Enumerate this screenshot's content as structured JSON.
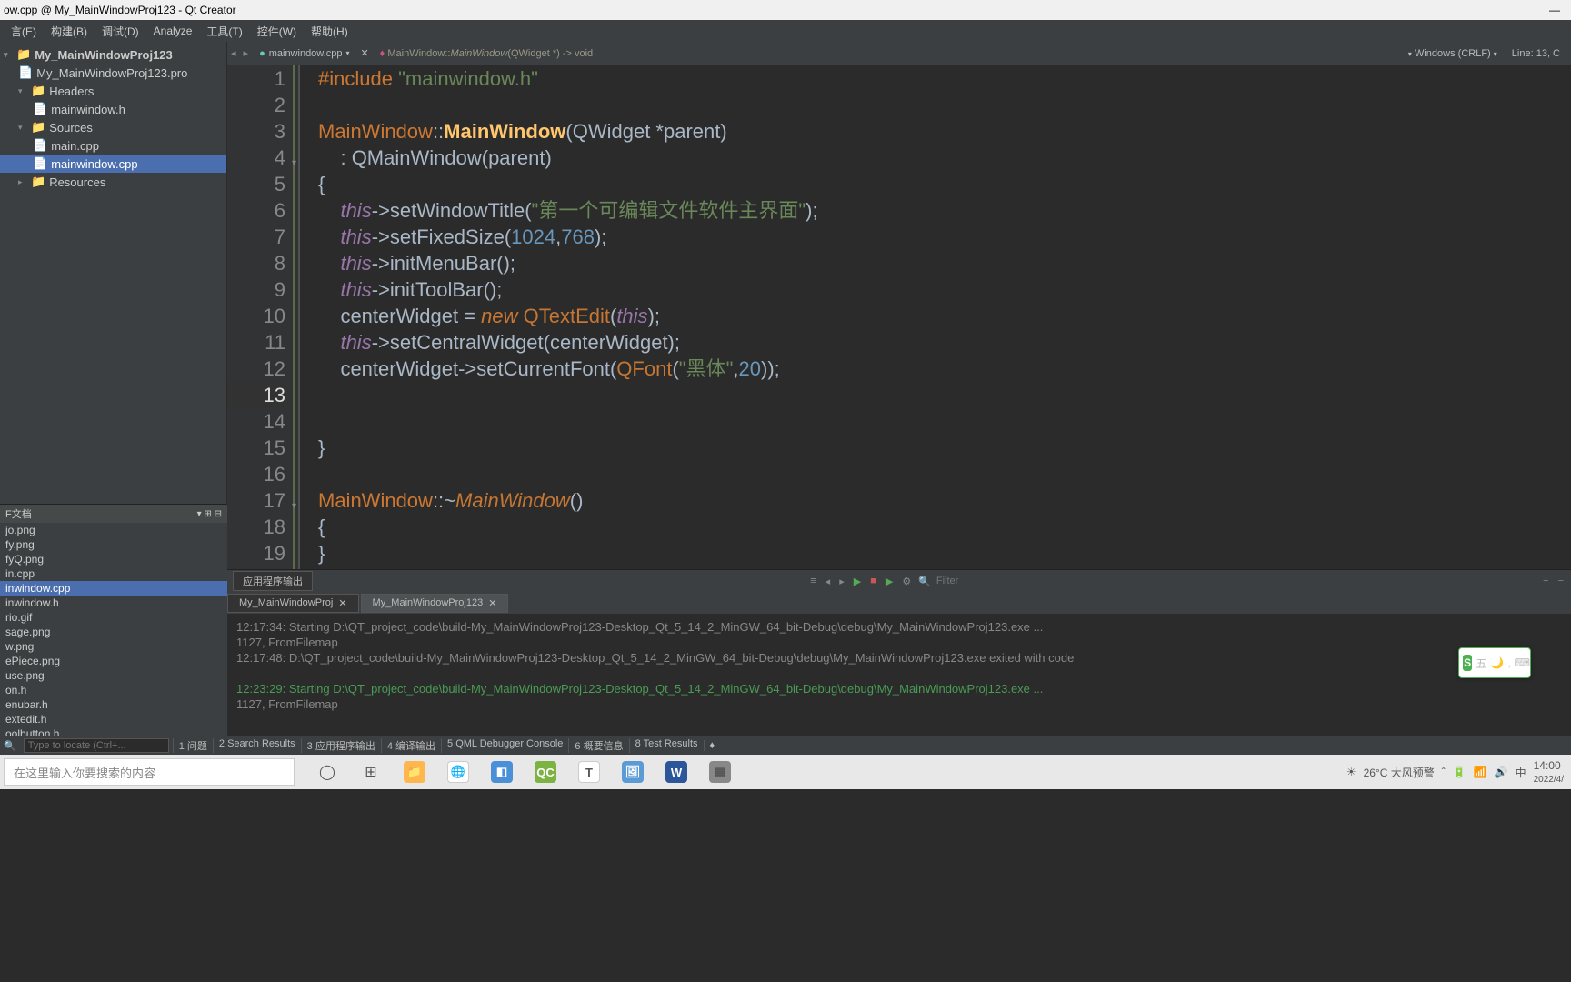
{
  "window": {
    "title": "ow.cpp @ My_MainWindowProj123 - Qt Creator",
    "minimize": "—"
  },
  "menubar": {
    "items": [
      {
        "label": "言(E)",
        "key": "E"
      },
      {
        "label": "构建(B)",
        "key": "B"
      },
      {
        "label": "调试(D)",
        "key": "D"
      },
      {
        "label": "Analyze",
        "key": ""
      },
      {
        "label": "工具(T)",
        "key": "T"
      },
      {
        "label": "控件(W)",
        "key": "W"
      },
      {
        "label": "帮助(H)",
        "key": "H"
      }
    ]
  },
  "project_tree": {
    "root": "My_MainWindowProj123",
    "pro_file": "My_MainWindowProj123.pro",
    "headers_folder": "Headers",
    "header_file": "mainwindow.h",
    "sources_folder": "Sources",
    "main_cpp": "main.cpp",
    "mainwindow_cpp": "mainwindow.cpp",
    "resources_folder": "Resources"
  },
  "editor": {
    "filename": "mainwindow.cpp",
    "breadcrumb_class": "MainWindow::",
    "breadcrumb_func": "MainWindow",
    "breadcrumb_sig": "(QWidget *) -> void",
    "encoding": "Windows (CRLF)",
    "cursor_pos": "Line: 13, C",
    "code_lines": [
      {
        "n": 1,
        "tokens": [
          [
            "kw-pre",
            "#include "
          ],
          [
            "kw-str",
            "\"mainwindow.h\""
          ]
        ]
      },
      {
        "n": 2,
        "tokens": []
      },
      {
        "n": 3,
        "tokens": [
          [
            "kw-class",
            "MainWindow"
          ],
          [
            "kw-punct",
            "::"
          ],
          [
            "kw-func",
            "MainWindow"
          ],
          [
            "kw-punct",
            "("
          ],
          [
            "",
            "QWidget *parent"
          ],
          [
            "kw-punct",
            ")"
          ]
        ]
      },
      {
        "n": 4,
        "fold": true,
        "tokens": [
          [
            "",
            "    : "
          ],
          [
            "",
            "QMainWindow"
          ],
          [
            "kw-punct",
            "("
          ],
          [
            "",
            "parent"
          ],
          [
            "kw-punct",
            ")"
          ]
        ]
      },
      {
        "n": 5,
        "tokens": [
          [
            "kw-punct",
            "{"
          ]
        ]
      },
      {
        "n": 6,
        "tokens": [
          [
            "",
            "    "
          ],
          [
            "kw-this",
            "this"
          ],
          [
            "kw-punct",
            "->setWindowTitle("
          ],
          [
            "kw-str",
            "\"第一个可编辑文件软件主界面\""
          ],
          [
            "kw-punct",
            ");"
          ]
        ]
      },
      {
        "n": 7,
        "tokens": [
          [
            "",
            "    "
          ],
          [
            "kw-this",
            "this"
          ],
          [
            "kw-punct",
            "->setFixedSize("
          ],
          [
            "kw-num",
            "1024"
          ],
          [
            "kw-punct",
            ","
          ],
          [
            "kw-num",
            "768"
          ],
          [
            "kw-punct",
            ");"
          ]
        ]
      },
      {
        "n": 8,
        "tokens": [
          [
            "",
            "    "
          ],
          [
            "kw-this",
            "this"
          ],
          [
            "kw-punct",
            "->initMenuBar();"
          ]
        ]
      },
      {
        "n": 9,
        "tokens": [
          [
            "",
            "    "
          ],
          [
            "kw-this",
            "this"
          ],
          [
            "kw-punct",
            "->initToolBar();"
          ]
        ]
      },
      {
        "n": 10,
        "tokens": [
          [
            "",
            "    centerWidget = "
          ],
          [
            "kw-new",
            "new"
          ],
          [
            "",
            ""
          ],
          [
            "kw-type",
            " QTextEdit"
          ],
          [
            "kw-punct",
            "("
          ],
          [
            "kw-this",
            "this"
          ],
          [
            "kw-punct",
            ");"
          ]
        ]
      },
      {
        "n": 11,
        "tokens": [
          [
            "",
            "    "
          ],
          [
            "kw-this",
            "this"
          ],
          [
            "kw-punct",
            "->setCentralWidget(centerWidget);"
          ]
        ]
      },
      {
        "n": 12,
        "tokens": [
          [
            "",
            "    centerWidget->setCurrentFont("
          ],
          [
            "kw-type",
            "QFont"
          ],
          [
            "kw-punct",
            "("
          ],
          [
            "kw-str",
            "\"黑体\""
          ],
          [
            "kw-punct",
            ","
          ],
          [
            "kw-num",
            "20"
          ],
          [
            "kw-punct",
            "));"
          ]
        ]
      },
      {
        "n": 13,
        "current": true,
        "tokens": []
      },
      {
        "n": 14,
        "tokens": []
      },
      {
        "n": 15,
        "tokens": [
          [
            "kw-punct",
            "}"
          ]
        ]
      },
      {
        "n": 16,
        "tokens": []
      },
      {
        "n": 17,
        "fold": true,
        "tokens": [
          [
            "kw-class",
            "MainWindow"
          ],
          [
            "kw-punct",
            "::~"
          ],
          [
            "kw-member",
            "MainWindow"
          ],
          [
            "kw-punct",
            "()"
          ]
        ]
      },
      {
        "n": 18,
        "tokens": [
          [
            "kw-punct",
            "{"
          ]
        ]
      },
      {
        "n": 19,
        "tokens": [
          [
            "kw-punct",
            "}"
          ]
        ]
      }
    ]
  },
  "open_docs": {
    "title": "F文档",
    "items": [
      "jo.png",
      "fy.png",
      "fyQ.png",
      "in.cpp",
      "inwindow.cpp",
      "inwindow.h",
      "rio.gif",
      "sage.png",
      "w.png",
      "ePiece.png",
      "use.png",
      "on.h",
      "enubar.h",
      "extedit.h",
      "oolbutton.h"
    ],
    "selected": "inwindow.cpp"
  },
  "output": {
    "title": "应用程序输出",
    "filter_placeholder": "Filter",
    "tabs": [
      {
        "label": "My_MainWindowProj",
        "close": true
      },
      {
        "label": "My_MainWindowProj123",
        "close": true,
        "active": true
      }
    ],
    "lines": [
      {
        "text": "12:17:34: Starting D:\\QT_project_code\\build-My_MainWindowProj123-Desktop_Qt_5_14_2_MinGW_64_bit-Debug\\debug\\My_MainWindowProj123.exe ..."
      },
      {
        "text": "1127, FromFilemap"
      },
      {
        "text": "12:17:48: D:\\QT_project_code\\build-My_MainWindowProj123-Desktop_Qt_5_14_2_MinGW_64_bit-Debug\\debug\\My_MainWindowProj123.exe exited with code"
      },
      {
        "text": ""
      },
      {
        "text": "12:23:29: Starting D:\\QT_project_code\\build-My_MainWindowProj123-Desktop_Qt_5_14_2_MinGW_64_bit-Debug\\debug\\My_MainWindowProj123.exe ...",
        "green": true
      },
      {
        "text": "1127, FromFilemap"
      }
    ]
  },
  "locator": {
    "placeholder": "Type to locate (Ctrl+...",
    "icon": "🔍",
    "tabs": [
      "1 问题",
      "2 Search Results",
      "3 应用程序输出",
      "4 编译输出",
      "5 QML Debugger Console",
      "6 概要信息",
      "8 Test Results"
    ]
  },
  "taskbar": {
    "search_placeholder": "在这里输入你要搜索的内容",
    "weather": "26°C 大风预警",
    "ime": "中",
    "time": "14:00",
    "date": "2022/4/"
  },
  "ime_floater": {
    "s": "S",
    "label": "五",
    "punct": "·,"
  }
}
